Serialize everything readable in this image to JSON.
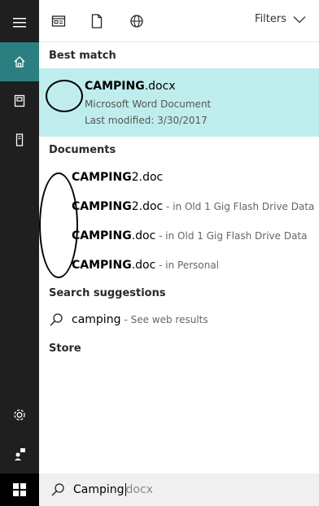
{
  "filters_label": "Filters",
  "best_match": {
    "header": "Best match",
    "name_bold": "CAMPING",
    "name_rest": ".docx",
    "type": "Microsoft Word Document",
    "modified": "Last modified: 3/30/2017"
  },
  "documents": {
    "header": "Documents",
    "items": [
      {
        "name_bold": "CAMPING",
        "name_rest": "2.doc",
        "location": ""
      },
      {
        "name_bold": "CAMPING",
        "name_rest": "2.doc",
        "location": " - in Old 1 Gig Flash Drive Data"
      },
      {
        "name_bold": "CAMPING",
        "name_rest": ".doc",
        "location": " - in Old 1 Gig Flash Drive Data"
      },
      {
        "name_bold": "CAMPING",
        "name_rest": ".doc",
        "location": " - in Personal"
      }
    ]
  },
  "suggestions": {
    "header": "Search suggestions",
    "query": "camping",
    "hint": "- See web results"
  },
  "store": {
    "header": "Store"
  },
  "search": {
    "typed": "Camping",
    "autocomplete": "docx"
  },
  "icons": {
    "rail": [
      "hamburger-icon",
      "home-icon",
      "notebook-icon",
      "tower-icon",
      "gear-icon",
      "feedback-icon",
      "windows-logo-icon"
    ],
    "toolbar": [
      "apps-icon",
      "document-icon",
      "globe-icon",
      "chevron-down-icon"
    ]
  },
  "colors": {
    "rail_bg": "#1f1f1f",
    "rail_active": "#2b7f80",
    "best_match_bg": "#bfeded",
    "searchbar_bg": "#f0f0f0"
  }
}
